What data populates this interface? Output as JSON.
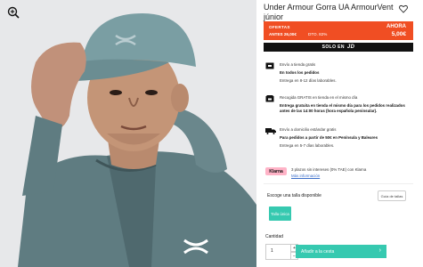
{
  "product": {
    "title": "Under Armour Gorra UA ArmourVent júnior",
    "image_logo": "UA"
  },
  "offer": {
    "label1": "OFERTAS",
    "label2": "ANTES 26,00€",
    "discount": "DTO. 82%",
    "now_label": "AHORA",
    "price": "5,00€"
  },
  "solo": {
    "text": "SOLO EN",
    "brand": "JD"
  },
  "delivery": [
    {
      "line1": "Envío a tienda gratis",
      "line2": "En todos los pedidos",
      "line3": "Entrega en 8-12 días laborables."
    },
    {
      "line1": "Recogida GRATIS en tienda en el mismo día",
      "line2": "Entrega gratuita en tienda el mismo día para los pedidos realizados antes de las 14:00 horas (hora española peninsular).",
      "line3": ""
    },
    {
      "line1": "Envío a domicilio estándar gratis",
      "line2": "Para pedidos a partir de 50€ en Península y Baleares",
      "line3": "Entrega en 5-7 días laborables."
    }
  ],
  "klarna": {
    "logo": "Klarna",
    "text": "3 plazos sin intereses (0% TAE) con Klarna",
    "link": "Más información"
  },
  "size": {
    "header": "Escoge una talla disponible",
    "guide": "Guía de tallas",
    "option": "Talla única"
  },
  "quantity": {
    "label": "Cantidad",
    "value": "1",
    "plus": "+",
    "minus": "−"
  },
  "add_to_cart": "Añadir a la cesta",
  "colors": {
    "accent": "#36c9b0",
    "offer": "#f04e23"
  }
}
